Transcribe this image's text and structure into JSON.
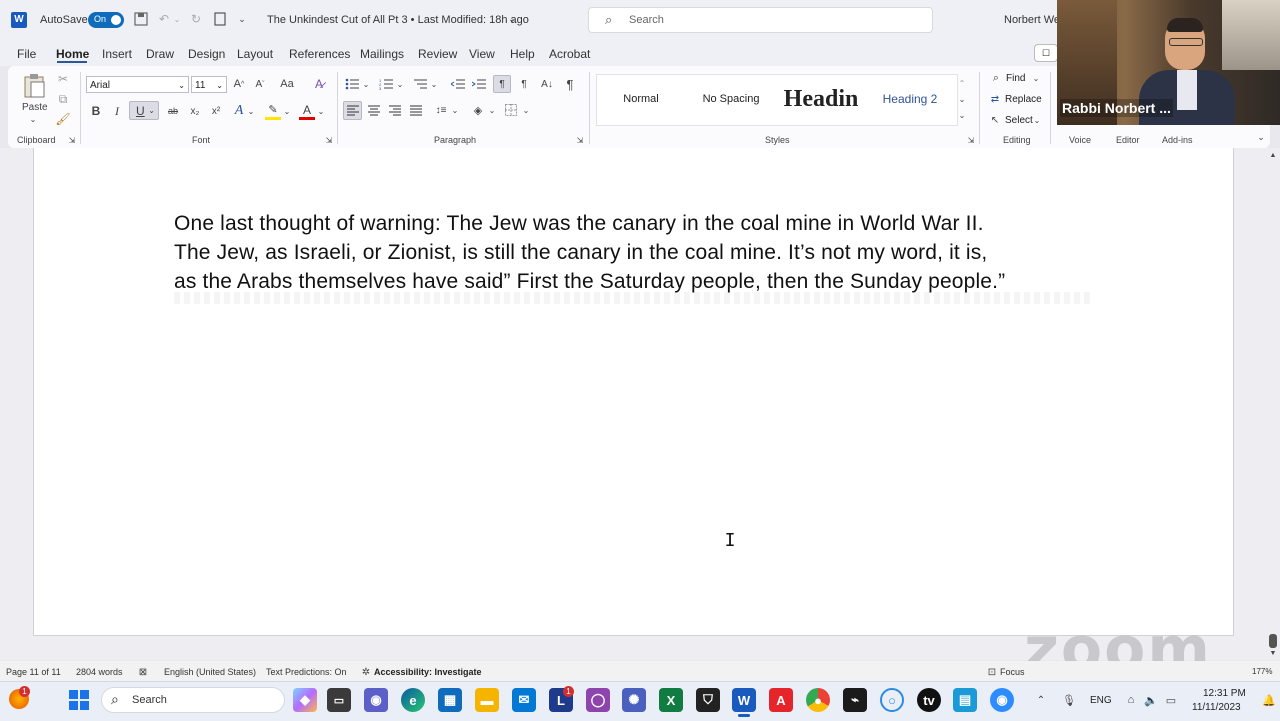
{
  "titlebar": {
    "app_logo": "W",
    "autosave_label": "AutoSave",
    "autosave_state": "On",
    "doc_title": "The Unkindest Cut of All Pt 3 • Last Modified: 18h ago",
    "search_placeholder": "Search",
    "user_name": "Norbert We"
  },
  "menu": {
    "items": [
      "File",
      "Home",
      "Insert",
      "Draw",
      "Design",
      "Layout",
      "References",
      "Mailings",
      "Review",
      "View",
      "Help",
      "Acrobat"
    ],
    "active": "Home"
  },
  "ribbon": {
    "clipboard": {
      "paste": "Paste",
      "group": "Clipboard"
    },
    "font": {
      "family": "Arial",
      "size": "11",
      "group": "Font",
      "bold": "B",
      "italic": "I",
      "underline": "U",
      "strike": "ab",
      "sub": "x₂",
      "sup": "x²",
      "grow": "A^",
      "shrink": "A˅",
      "case": "Aa",
      "effects": "A",
      "highlight": "ab",
      "color": "A"
    },
    "paragraph": {
      "group": "Paragraph"
    },
    "styles": {
      "group": "Styles",
      "items": [
        "Normal",
        "No Spacing",
        "Headin",
        "Heading 2"
      ]
    },
    "editing": {
      "group": "Editing",
      "find": "Find",
      "replace": "Replace",
      "select": "Select"
    },
    "voice": "Voice",
    "editor": "Editor",
    "addins": "Add-ins"
  },
  "video": {
    "name": "Rabbi Norbert ..."
  },
  "document": {
    "lines": [
      " One last thought of warning: The Jew was the canary in the coal mine in World War II.",
      "The Jew, as Israeli, or Zionist, is still the canary in the coal mine. It’s not my word, it is,",
      "as the Arabs themselves have said” First the Saturday people, then the Sunday people.”"
    ]
  },
  "status": {
    "page": "Page 11 of 11",
    "words": "2804 words",
    "language": "English (United States)",
    "predictions": "Text Predictions: On",
    "accessibility": "Accessibility: Investigate",
    "focus": "Focus",
    "zoom": "177%"
  },
  "watermark": "zoom",
  "taskbar": {
    "search": "Search",
    "lang": "ENG",
    "time": "12:31 PM",
    "date": "11/11/2023",
    "badge": "1",
    "badge2": "1"
  },
  "colors": {
    "accent": "#2b579a",
    "word_blue": "#185abd",
    "toggle": "#0f6cbd"
  }
}
